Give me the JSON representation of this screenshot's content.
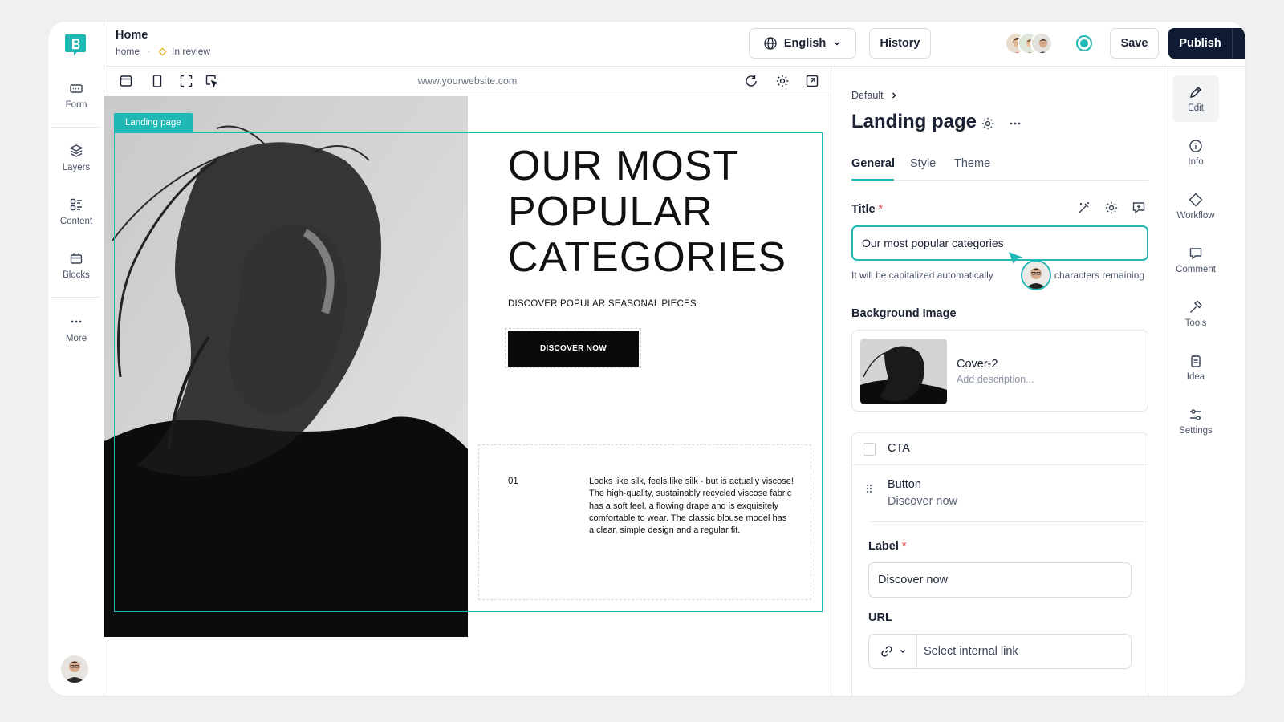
{
  "header": {
    "title": "Home",
    "slug": "home",
    "status": "In review",
    "language": "English",
    "history": "History",
    "save": "Save",
    "publish": "Publish"
  },
  "left_rail": [
    {
      "label": "Form",
      "icon": "form-icon"
    },
    {
      "label": "Layers",
      "icon": "layers-icon"
    },
    {
      "label": "Content",
      "icon": "content-icon"
    },
    {
      "label": "Blocks",
      "icon": "blocks-icon"
    },
    {
      "label": "More",
      "icon": "more-icon"
    }
  ],
  "canvas": {
    "url": "www.yourwebsite.com",
    "selection_tag": "Landing page",
    "hero_title_lines": [
      "OUR MOST",
      "POPULAR",
      "CATEGORIES"
    ],
    "hero_subtitle": "DISCOVER POPULAR SEASONAL PIECES",
    "hero_button": "DISCOVER NOW",
    "item_number": "01",
    "item_text": "Looks like silk, feels like silk - but is actually viscose! The high-quality, sustainably recycled viscose fabric has a soft feel, a flowing drape and is exquisitely comfortable to wear. The classic blouse model has a clear, simple design and a regular fit."
  },
  "panel": {
    "breadcrumb": "Default",
    "title": "Landing page",
    "tabs": [
      "General",
      "Style",
      "Theme"
    ],
    "active_tab": "General",
    "title_field": {
      "label": "Title",
      "value": "Our most popular categories",
      "helper": "It will be capitalized automatically",
      "counter": "characters remaining"
    },
    "background_image": {
      "label": "Background Image",
      "name": "Cover-2",
      "description_placeholder": "Add description..."
    },
    "cta": {
      "label": "CTA",
      "button_type": "Button",
      "button_value": "Discover now",
      "label_field": "Label",
      "label_value": "Discover now",
      "url_field": "URL",
      "url_placeholder": "Select internal link"
    }
  },
  "right_rail": [
    {
      "label": "Edit",
      "icon": "edit-icon"
    },
    {
      "label": "Info",
      "icon": "info-icon"
    },
    {
      "label": "Workflow",
      "icon": "workflow-icon"
    },
    {
      "label": "Comment",
      "icon": "comment-icon"
    },
    {
      "label": "Tools",
      "icon": "tools-icon"
    },
    {
      "label": "Idea",
      "icon": "idea-icon"
    },
    {
      "label": "Settings",
      "icon": "settings-icon"
    }
  ],
  "colors": {
    "accent": "#1fb8b5",
    "primary": "#0f1b33",
    "status": "#e4a400"
  }
}
